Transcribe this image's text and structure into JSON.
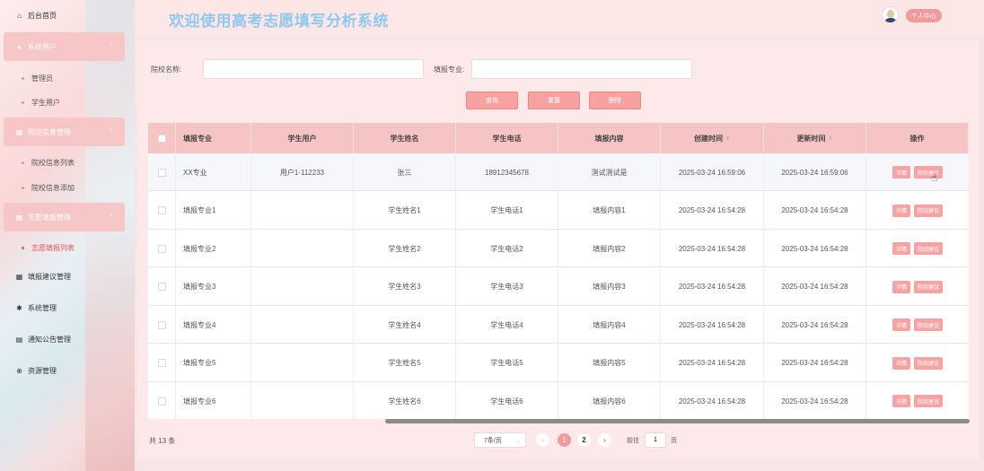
{
  "app": {
    "title": "欢迎使用高考志愿填写分析系统",
    "profile_label": "个人中心"
  },
  "sidebar": {
    "home": "后台首页",
    "groups": [
      {
        "label": "系统用户",
        "items": [
          "管理员",
          "学生用户"
        ]
      },
      {
        "label": "院校信息管理",
        "items": [
          "院校信息列表",
          "院校信息添加"
        ]
      },
      {
        "label": "志愿填报管理",
        "items": [
          "志愿填报列表"
        ]
      }
    ],
    "others": [
      "填报建议管理",
      "系统管理",
      "通知公告管理",
      "资源管理"
    ]
  },
  "search": {
    "school_label": "院校名称:",
    "school_value": "",
    "major_label": "填报专业:",
    "major_value": "",
    "buttons": [
      "查询",
      "重置",
      "删除"
    ]
  },
  "table": {
    "headers": [
      "填报专业",
      "学生用户",
      "学生姓名",
      "学生电话",
      "填报内容",
      "创建时间",
      "更新时间",
      "操作"
    ],
    "sortable_columns": [
      "创建时间",
      "更新时间"
    ],
    "actions": [
      "详情",
      "院校建议"
    ],
    "rows": [
      [
        "XX专业",
        "用户1-112233",
        "张三",
        "18912345678",
        "测试测试是",
        "2025-03-24 16:59:06",
        "2025-03-24 16:59:06"
      ],
      [
        "填报专业1",
        "",
        "学生姓名1",
        "学生电话1",
        "填报内容1",
        "2025-03-24 16:54:28",
        "2025-03-24 16:54:28"
      ],
      [
        "填报专业2",
        "",
        "学生姓名2",
        "学生电话2",
        "填报内容2",
        "2025-03-24 16:54:28",
        "2025-03-24 16:54:28"
      ],
      [
        "填报专业3",
        "",
        "学生姓名3",
        "学生电话3",
        "填报内容3",
        "2025-03-24 16:54:28",
        "2025-03-24 16:54:28"
      ],
      [
        "填报专业4",
        "",
        "学生姓名4",
        "学生电话4",
        "填报内容4",
        "2025-03-24 16:54:28",
        "2025-03-24 16:54:28"
      ],
      [
        "填报专业5",
        "",
        "学生姓名5",
        "学生电话5",
        "填报内容5",
        "2025-03-24 16:54:28",
        "2025-03-24 16:54:28"
      ],
      [
        "填报专业6",
        "",
        "学生姓名6",
        "学生电话6",
        "填报内容6",
        "2025-03-24 16:54:28",
        "2025-03-24 16:54:28"
      ]
    ]
  },
  "pagination": {
    "total": "共 13 条",
    "page_size": "7条/页",
    "pages": [
      "1",
      "2"
    ],
    "current": "1",
    "goto_label": "前往",
    "goto_value": "1",
    "goto_unit": "页"
  },
  "colors": {
    "accent": "#f7a1a1",
    "title": "#8fc9ef",
    "header_row": "#f7c4c4",
    "active_menu": "#e05a5a"
  },
  "icons": [
    "home-icon",
    "user-icon",
    "grid-icon",
    "settings-icon",
    "document-icon",
    "plus-circle-icon",
    "chevron-up-icon",
    "chevron-left-icon",
    "chevron-right-icon",
    "sort-icon",
    "hand-cursor-icon"
  ]
}
